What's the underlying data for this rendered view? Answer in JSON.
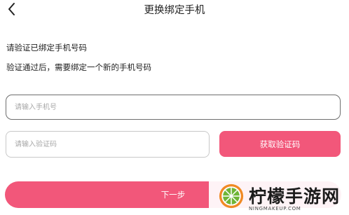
{
  "header": {
    "title": "更换绑定手机"
  },
  "info": {
    "line1": "请验证已绑定手机号码",
    "line2": "验证通过后，需要绑定一个新的手机号码"
  },
  "phone_field": {
    "value": "",
    "placeholder": "请输入手机号"
  },
  "code_field": {
    "value": "",
    "placeholder": "请输入验证码"
  },
  "buttons": {
    "get_code": "获取验证码",
    "next": "下一步"
  },
  "watermark": {
    "text": "柠檬手游网",
    "sub": "NINGMAKEUP.COM"
  },
  "colors": {
    "accent": "#f2577a",
    "logo_orange": "#f08a24",
    "logo_green": "#6fb536"
  },
  "icons": {
    "back": "chevron-left-icon",
    "logo": "lemon-slice-icon"
  }
}
